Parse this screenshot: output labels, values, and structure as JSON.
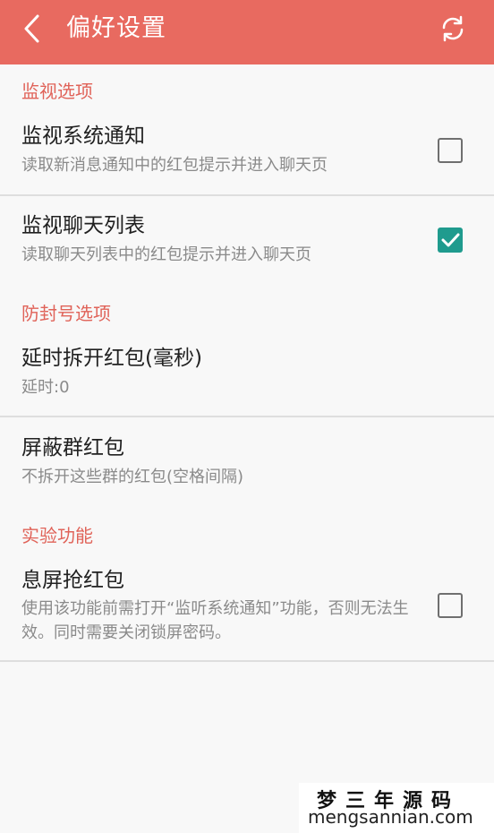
{
  "topbar": {
    "title": "偏好设置",
    "back_icon": "chevron-left-icon",
    "refresh_icon": "refresh-icon",
    "color": "#e86a60"
  },
  "sections": [
    {
      "header": "监视选项",
      "items": [
        {
          "title": "监视系统通知",
          "summary": "读取新消息通知中的红包提示并进入聊天页",
          "checked": false
        },
        {
          "title": "监视聊天列表",
          "summary": "读取聊天列表中的红包提示并进入聊天页",
          "checked": true
        }
      ]
    },
    {
      "header": "防封号选项",
      "items": [
        {
          "title": "延时拆开红包(毫秒)",
          "summary": "延时:0"
        },
        {
          "title": "屏蔽群红包",
          "summary": "不拆开这些群的红包(空格间隔)"
        }
      ]
    },
    {
      "header": "实验功能",
      "items": [
        {
          "title": "息屏抢红包",
          "summary": "使用该功能前需打开“监听系统通知”功能，否则无法生效。同时需要关闭锁屏密码。",
          "checked": false
        }
      ]
    }
  ],
  "watermark": {
    "title": "梦三年源码",
    "url": "mengsannian.com"
  },
  "colors": {
    "accent": "#e06359",
    "checkbox_checked": "#1f9b8e"
  }
}
